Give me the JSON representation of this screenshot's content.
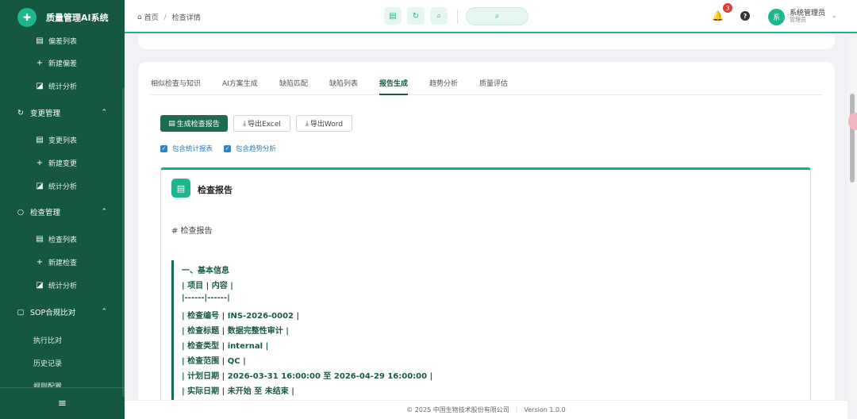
{
  "app": {
    "logo_char": "✚",
    "title": "质量管理AI系统"
  },
  "sidebar": {
    "items": [
      {
        "label": "偏差列表",
        "icon": "list-icon",
        "glyph": "▤"
      },
      {
        "label": "新建偏差",
        "icon": "plus-icon",
        "glyph": "+"
      },
      {
        "label": "统计分析",
        "icon": "chart-icon",
        "glyph": "◪"
      }
    ],
    "groups": [
      {
        "label": "变更管理",
        "icon": "refresh-icon",
        "glyph": "↻",
        "chevron": "⌃",
        "items": [
          {
            "label": "变更列表",
            "glyph": "▤"
          },
          {
            "label": "新建变更",
            "glyph": "+"
          },
          {
            "label": "统计分析",
            "glyph": "◪"
          }
        ]
      },
      {
        "label": "检查管理",
        "icon": "search-icon",
        "glyph": "○",
        "chevron": "⌃",
        "items": [
          {
            "label": "检查列表",
            "glyph": "▤"
          },
          {
            "label": "新建检查",
            "glyph": "+"
          },
          {
            "label": "统计分析",
            "glyph": "◪"
          }
        ]
      },
      {
        "label": "SOP合规比对",
        "icon": "document-icon",
        "glyph": "▢",
        "chevron": "⌃",
        "items": [
          {
            "label": "执行比对"
          },
          {
            "label": "历史记录"
          },
          {
            "label": "规则配置"
          }
        ]
      }
    ],
    "collapse_glyph": "≡"
  },
  "header": {
    "breadcrumb": {
      "home_glyph": "⌂",
      "home": "首页",
      "separator": "/",
      "current": "检查详情"
    },
    "tools": [
      {
        "icon": "document-icon",
        "glyph": "▤"
      },
      {
        "icon": "refresh-icon",
        "glyph": "↻"
      },
      {
        "icon": "search-icon",
        "glyph": "⌕"
      }
    ],
    "search_glyph": "⌕",
    "notifications": {
      "glyph": "🔔",
      "count": "3"
    },
    "help_glyph": "?",
    "user": {
      "avatar": "系",
      "name": "系统管理员",
      "role": "管理员",
      "chevron": "⌄"
    }
  },
  "tabs": [
    {
      "label": "相似检查与知识",
      "active": false
    },
    {
      "label": "AI方案生成",
      "active": false
    },
    {
      "label": "缺陷匹配",
      "active": false
    },
    {
      "label": "缺陷列表",
      "active": false
    },
    {
      "label": "报告生成",
      "active": true
    },
    {
      "label": "趋势分析",
      "active": false
    },
    {
      "label": "质量评估",
      "active": false
    }
  ],
  "actions": {
    "generate": "生成检查报告",
    "export_excel": "导出Excel",
    "export_word": "导出Word",
    "doc_glyph": "▤",
    "download_glyph": "⤓"
  },
  "options": {
    "include_stats": "包含统计报表",
    "include_trend": "包含趋势分析",
    "checked_glyph": "✓"
  },
  "report": {
    "icon_glyph": "▤",
    "title": "检查报告",
    "heading": "# 检查报告",
    "lines": [
      "一、基本信息",
      "| 项目 | 内容 |",
      "|------|------|",
      "| 检查编号 | INS-2026-0002 |",
      "| 检查标题 | 数据完整性审计 |",
      "| 检查类型 | internal |",
      "| 检查范围 | QC |",
      "| 计划日期 | 2026-03-31 16:00:00 至 2026-04-29 16:00:00 |",
      "| 实际日期 | 未开始 至 未结束 |"
    ]
  },
  "footer": {
    "copyright": "© 2025 中国生物技术股份有限公司",
    "separator": "|",
    "version": "Version 1.0.0"
  }
}
